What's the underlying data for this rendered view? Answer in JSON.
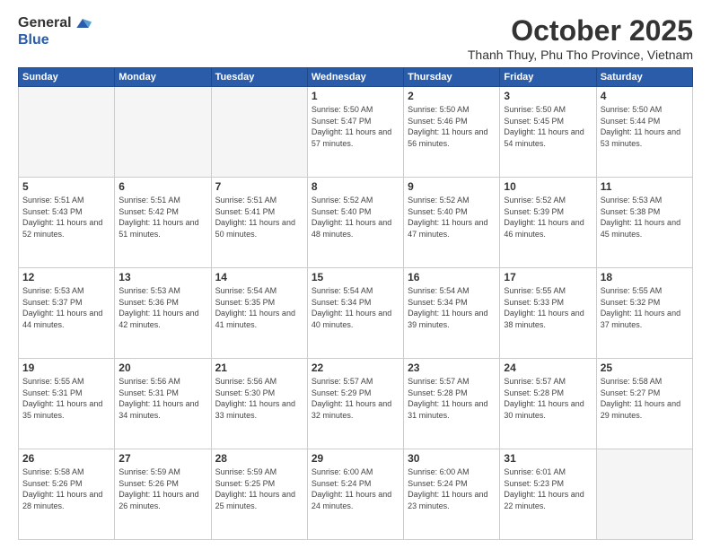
{
  "logo": {
    "general": "General",
    "blue": "Blue"
  },
  "header": {
    "month": "October 2025",
    "location": "Thanh Thuy, Phu Tho Province, Vietnam"
  },
  "days_of_week": [
    "Sunday",
    "Monday",
    "Tuesday",
    "Wednesday",
    "Thursday",
    "Friday",
    "Saturday"
  ],
  "weeks": [
    [
      {
        "day": "",
        "info": ""
      },
      {
        "day": "",
        "info": ""
      },
      {
        "day": "",
        "info": ""
      },
      {
        "day": "1",
        "info": "Sunrise: 5:50 AM\nSunset: 5:47 PM\nDaylight: 11 hours\nand 57 minutes."
      },
      {
        "day": "2",
        "info": "Sunrise: 5:50 AM\nSunset: 5:46 PM\nDaylight: 11 hours\nand 56 minutes."
      },
      {
        "day": "3",
        "info": "Sunrise: 5:50 AM\nSunset: 5:45 PM\nDaylight: 11 hours\nand 54 minutes."
      },
      {
        "day": "4",
        "info": "Sunrise: 5:50 AM\nSunset: 5:44 PM\nDaylight: 11 hours\nand 53 minutes."
      }
    ],
    [
      {
        "day": "5",
        "info": "Sunrise: 5:51 AM\nSunset: 5:43 PM\nDaylight: 11 hours\nand 52 minutes."
      },
      {
        "day": "6",
        "info": "Sunrise: 5:51 AM\nSunset: 5:42 PM\nDaylight: 11 hours\nand 51 minutes."
      },
      {
        "day": "7",
        "info": "Sunrise: 5:51 AM\nSunset: 5:41 PM\nDaylight: 11 hours\nand 50 minutes."
      },
      {
        "day": "8",
        "info": "Sunrise: 5:52 AM\nSunset: 5:40 PM\nDaylight: 11 hours\nand 48 minutes."
      },
      {
        "day": "9",
        "info": "Sunrise: 5:52 AM\nSunset: 5:40 PM\nDaylight: 11 hours\nand 47 minutes."
      },
      {
        "day": "10",
        "info": "Sunrise: 5:52 AM\nSunset: 5:39 PM\nDaylight: 11 hours\nand 46 minutes."
      },
      {
        "day": "11",
        "info": "Sunrise: 5:53 AM\nSunset: 5:38 PM\nDaylight: 11 hours\nand 45 minutes."
      }
    ],
    [
      {
        "day": "12",
        "info": "Sunrise: 5:53 AM\nSunset: 5:37 PM\nDaylight: 11 hours\nand 44 minutes."
      },
      {
        "day": "13",
        "info": "Sunrise: 5:53 AM\nSunset: 5:36 PM\nDaylight: 11 hours\nand 42 minutes."
      },
      {
        "day": "14",
        "info": "Sunrise: 5:54 AM\nSunset: 5:35 PM\nDaylight: 11 hours\nand 41 minutes."
      },
      {
        "day": "15",
        "info": "Sunrise: 5:54 AM\nSunset: 5:34 PM\nDaylight: 11 hours\nand 40 minutes."
      },
      {
        "day": "16",
        "info": "Sunrise: 5:54 AM\nSunset: 5:34 PM\nDaylight: 11 hours\nand 39 minutes."
      },
      {
        "day": "17",
        "info": "Sunrise: 5:55 AM\nSunset: 5:33 PM\nDaylight: 11 hours\nand 38 minutes."
      },
      {
        "day": "18",
        "info": "Sunrise: 5:55 AM\nSunset: 5:32 PM\nDaylight: 11 hours\nand 37 minutes."
      }
    ],
    [
      {
        "day": "19",
        "info": "Sunrise: 5:55 AM\nSunset: 5:31 PM\nDaylight: 11 hours\nand 35 minutes."
      },
      {
        "day": "20",
        "info": "Sunrise: 5:56 AM\nSunset: 5:31 PM\nDaylight: 11 hours\nand 34 minutes."
      },
      {
        "day": "21",
        "info": "Sunrise: 5:56 AM\nSunset: 5:30 PM\nDaylight: 11 hours\nand 33 minutes."
      },
      {
        "day": "22",
        "info": "Sunrise: 5:57 AM\nSunset: 5:29 PM\nDaylight: 11 hours\nand 32 minutes."
      },
      {
        "day": "23",
        "info": "Sunrise: 5:57 AM\nSunset: 5:28 PM\nDaylight: 11 hours\nand 31 minutes."
      },
      {
        "day": "24",
        "info": "Sunrise: 5:57 AM\nSunset: 5:28 PM\nDaylight: 11 hours\nand 30 minutes."
      },
      {
        "day": "25",
        "info": "Sunrise: 5:58 AM\nSunset: 5:27 PM\nDaylight: 11 hours\nand 29 minutes."
      }
    ],
    [
      {
        "day": "26",
        "info": "Sunrise: 5:58 AM\nSunset: 5:26 PM\nDaylight: 11 hours\nand 28 minutes."
      },
      {
        "day": "27",
        "info": "Sunrise: 5:59 AM\nSunset: 5:26 PM\nDaylight: 11 hours\nand 26 minutes."
      },
      {
        "day": "28",
        "info": "Sunrise: 5:59 AM\nSunset: 5:25 PM\nDaylight: 11 hours\nand 25 minutes."
      },
      {
        "day": "29",
        "info": "Sunrise: 6:00 AM\nSunset: 5:24 PM\nDaylight: 11 hours\nand 24 minutes."
      },
      {
        "day": "30",
        "info": "Sunrise: 6:00 AM\nSunset: 5:24 PM\nDaylight: 11 hours\nand 23 minutes."
      },
      {
        "day": "31",
        "info": "Sunrise: 6:01 AM\nSunset: 5:23 PM\nDaylight: 11 hours\nand 22 minutes."
      },
      {
        "day": "",
        "info": ""
      }
    ]
  ]
}
